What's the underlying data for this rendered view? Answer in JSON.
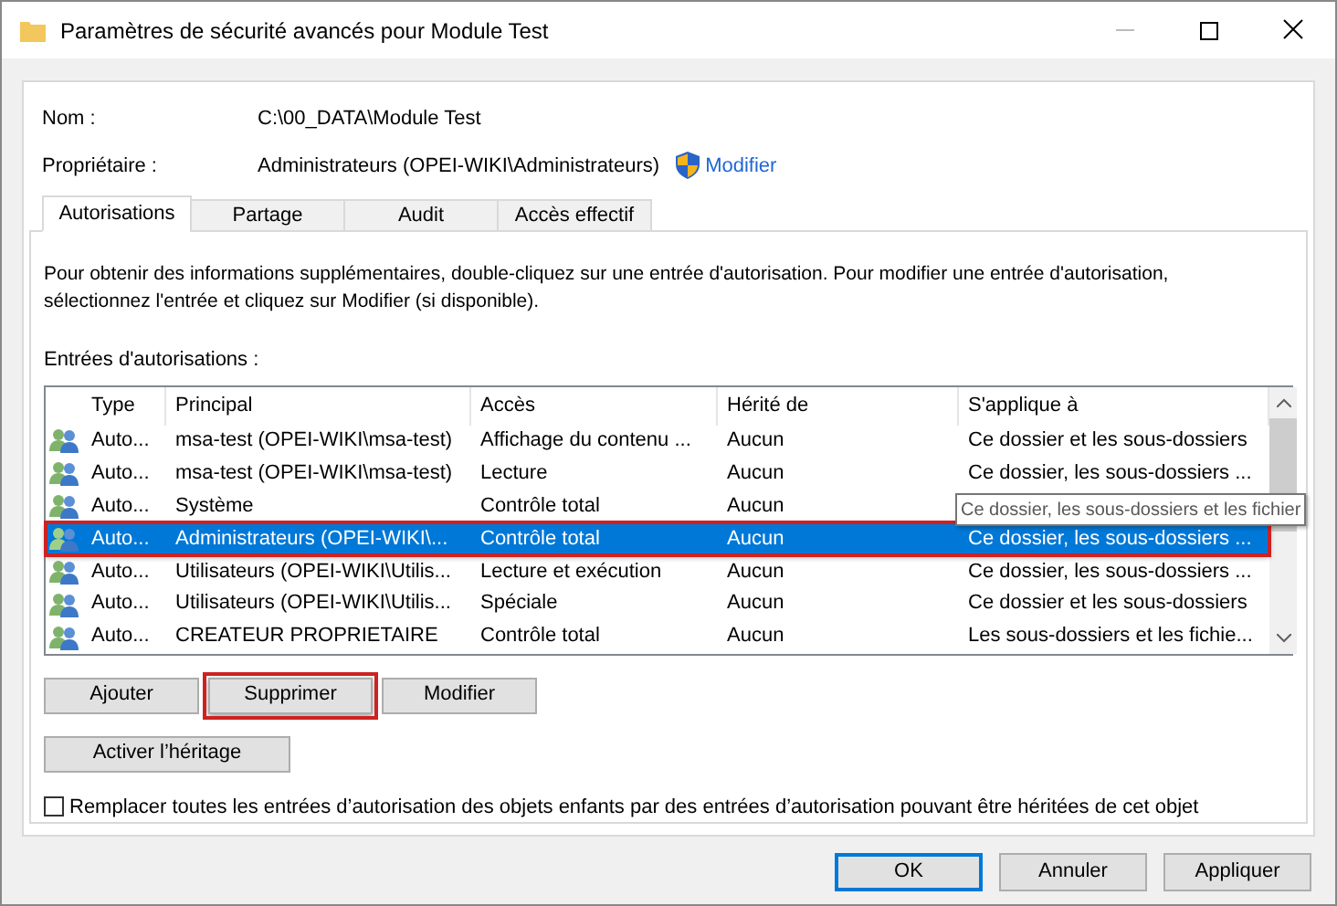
{
  "window": {
    "title": "Paramètres de sécurité avancés pour Module Test"
  },
  "fields": [
    {
      "label": "Nom :",
      "value": "C:\\00_DATA\\Module Test"
    },
    {
      "label": "Propriétaire :",
      "value": "Administrateurs (OPEI-WIKI\\Administrateurs)",
      "link": "Modifier"
    }
  ],
  "tabs": [
    {
      "label": "Autorisations",
      "selected": true
    },
    {
      "label": "Partage",
      "selected": false
    },
    {
      "label": "Audit",
      "selected": false
    },
    {
      "label": "Accès effectif",
      "selected": false
    }
  ],
  "info": "Pour obtenir des informations supplémentaires, double-cliquez sur une entrée d'autorisation. Pour modifier une entrée d'autorisation, sélectionnez l'entrée et cliquez sur Modifier (si disponible).",
  "list_label": "Entrées d'autorisations :",
  "table": {
    "columns": [
      "Type",
      "Principal",
      "Accès",
      "Hérité de",
      "S'applique à"
    ],
    "rows": [
      {
        "cells": [
          "Auto...",
          "msa-test (OPEI-WIKI\\msa-test)",
          "Affichage du contenu ...",
          "Aucun",
          "Ce dossier et les sous-dossiers"
        ],
        "selected": false,
        "highlighted": false
      },
      {
        "cells": [
          "Auto...",
          "msa-test (OPEI-WIKI\\msa-test)",
          "Lecture",
          "Aucun",
          "Ce dossier, les sous-dossiers ..."
        ],
        "selected": false,
        "highlighted": false
      },
      {
        "cells": [
          "Auto...",
          "Système",
          "Contrôle total",
          "Aucun"
        ],
        "selected": false,
        "highlighted": false
      },
      {
        "cells": [
          "Auto...",
          "Administrateurs (OPEI-WIKI\\...",
          "Contrôle total",
          "Aucun",
          "Ce dossier, les sous-dossiers ..."
        ],
        "selected": true,
        "highlighted": true
      },
      {
        "cells": [
          "Auto...",
          "Utilisateurs (OPEI-WIKI\\Utilis...",
          "Lecture et exécution",
          "Aucun",
          "Ce dossier, les sous-dossiers ..."
        ],
        "selected": false,
        "highlighted": false
      },
      {
        "cells": [
          "Auto...",
          "Utilisateurs (OPEI-WIKI\\Utilis...",
          "Spéciale",
          "Aucun",
          "Ce dossier et les sous-dossiers"
        ],
        "selected": false,
        "highlighted": false
      },
      {
        "cells": [
          "Auto...",
          "CREATEUR PROPRIETAIRE",
          "Contrôle total",
          "Aucun",
          "Les sous-dossiers et les fichie..."
        ],
        "selected": false,
        "highlighted": false
      }
    ],
    "tooltip": "Ce dossier, les sous-dossiers et les fichier"
  },
  "buttons": [
    {
      "label": "Ajouter",
      "highlighted": false
    },
    {
      "label": "Supprimer",
      "highlighted": true
    },
    {
      "label": "Modifier",
      "highlighted": false
    }
  ],
  "inherit_button": "Activer l’héritage",
  "replace_option": {
    "label": "Remplacer toutes les entrées d’autorisation des objets enfants par des entrées d’autorisation pouvant être héritées de cet objet",
    "checked": false
  },
  "footer_buttons": [
    {
      "label": "OK",
      "default": true
    },
    {
      "label": "Annuler",
      "default": false
    },
    {
      "label": "Appliquer",
      "default": false
    }
  ]
}
